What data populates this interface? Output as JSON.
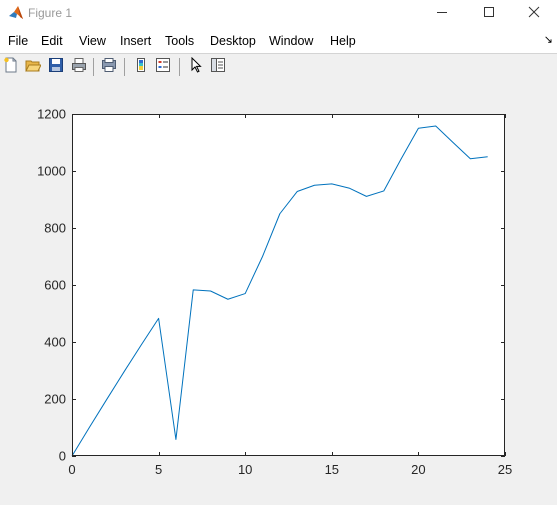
{
  "window": {
    "title": "Figure 1",
    "minimize_icon": "minimize-icon",
    "maximize_icon": "maximize-icon",
    "close_icon": "close-icon"
  },
  "menu": {
    "items": [
      "File",
      "Edit",
      "View",
      "Insert",
      "Tools",
      "Desktop",
      "Window",
      "Help"
    ]
  },
  "toolbar": {
    "icons": [
      "new-figure-icon",
      "open-file-icon",
      "save-icon",
      "print-icon",
      "print-preview-icon",
      "colorbar-icon",
      "legend-icon",
      "select-arrow-icon",
      "property-editor-icon"
    ]
  },
  "chart_data": {
    "type": "line",
    "title": "",
    "xlabel": "",
    "ylabel": "",
    "xlim": [
      0,
      25
    ],
    "ylim": [
      0,
      1200
    ],
    "xticks": [
      0,
      5,
      10,
      15,
      20,
      25
    ],
    "yticks": [
      0,
      200,
      400,
      600,
      800,
      1000,
      1200
    ],
    "grid": false,
    "line_color": "#0072BD",
    "x": [
      0,
      1,
      2,
      3,
      4,
      5,
      6,
      7,
      8,
      9,
      10,
      11,
      12,
      13,
      14,
      15,
      16,
      17,
      18,
      19,
      20,
      21,
      22,
      23,
      24
    ],
    "y": [
      0,
      100,
      198,
      295,
      390,
      483,
      58,
      583,
      579,
      550,
      570,
      700,
      850,
      928,
      950,
      955,
      940,
      911,
      930,
      1042,
      1150,
      1158,
      1100,
      1043,
      1050
    ]
  }
}
